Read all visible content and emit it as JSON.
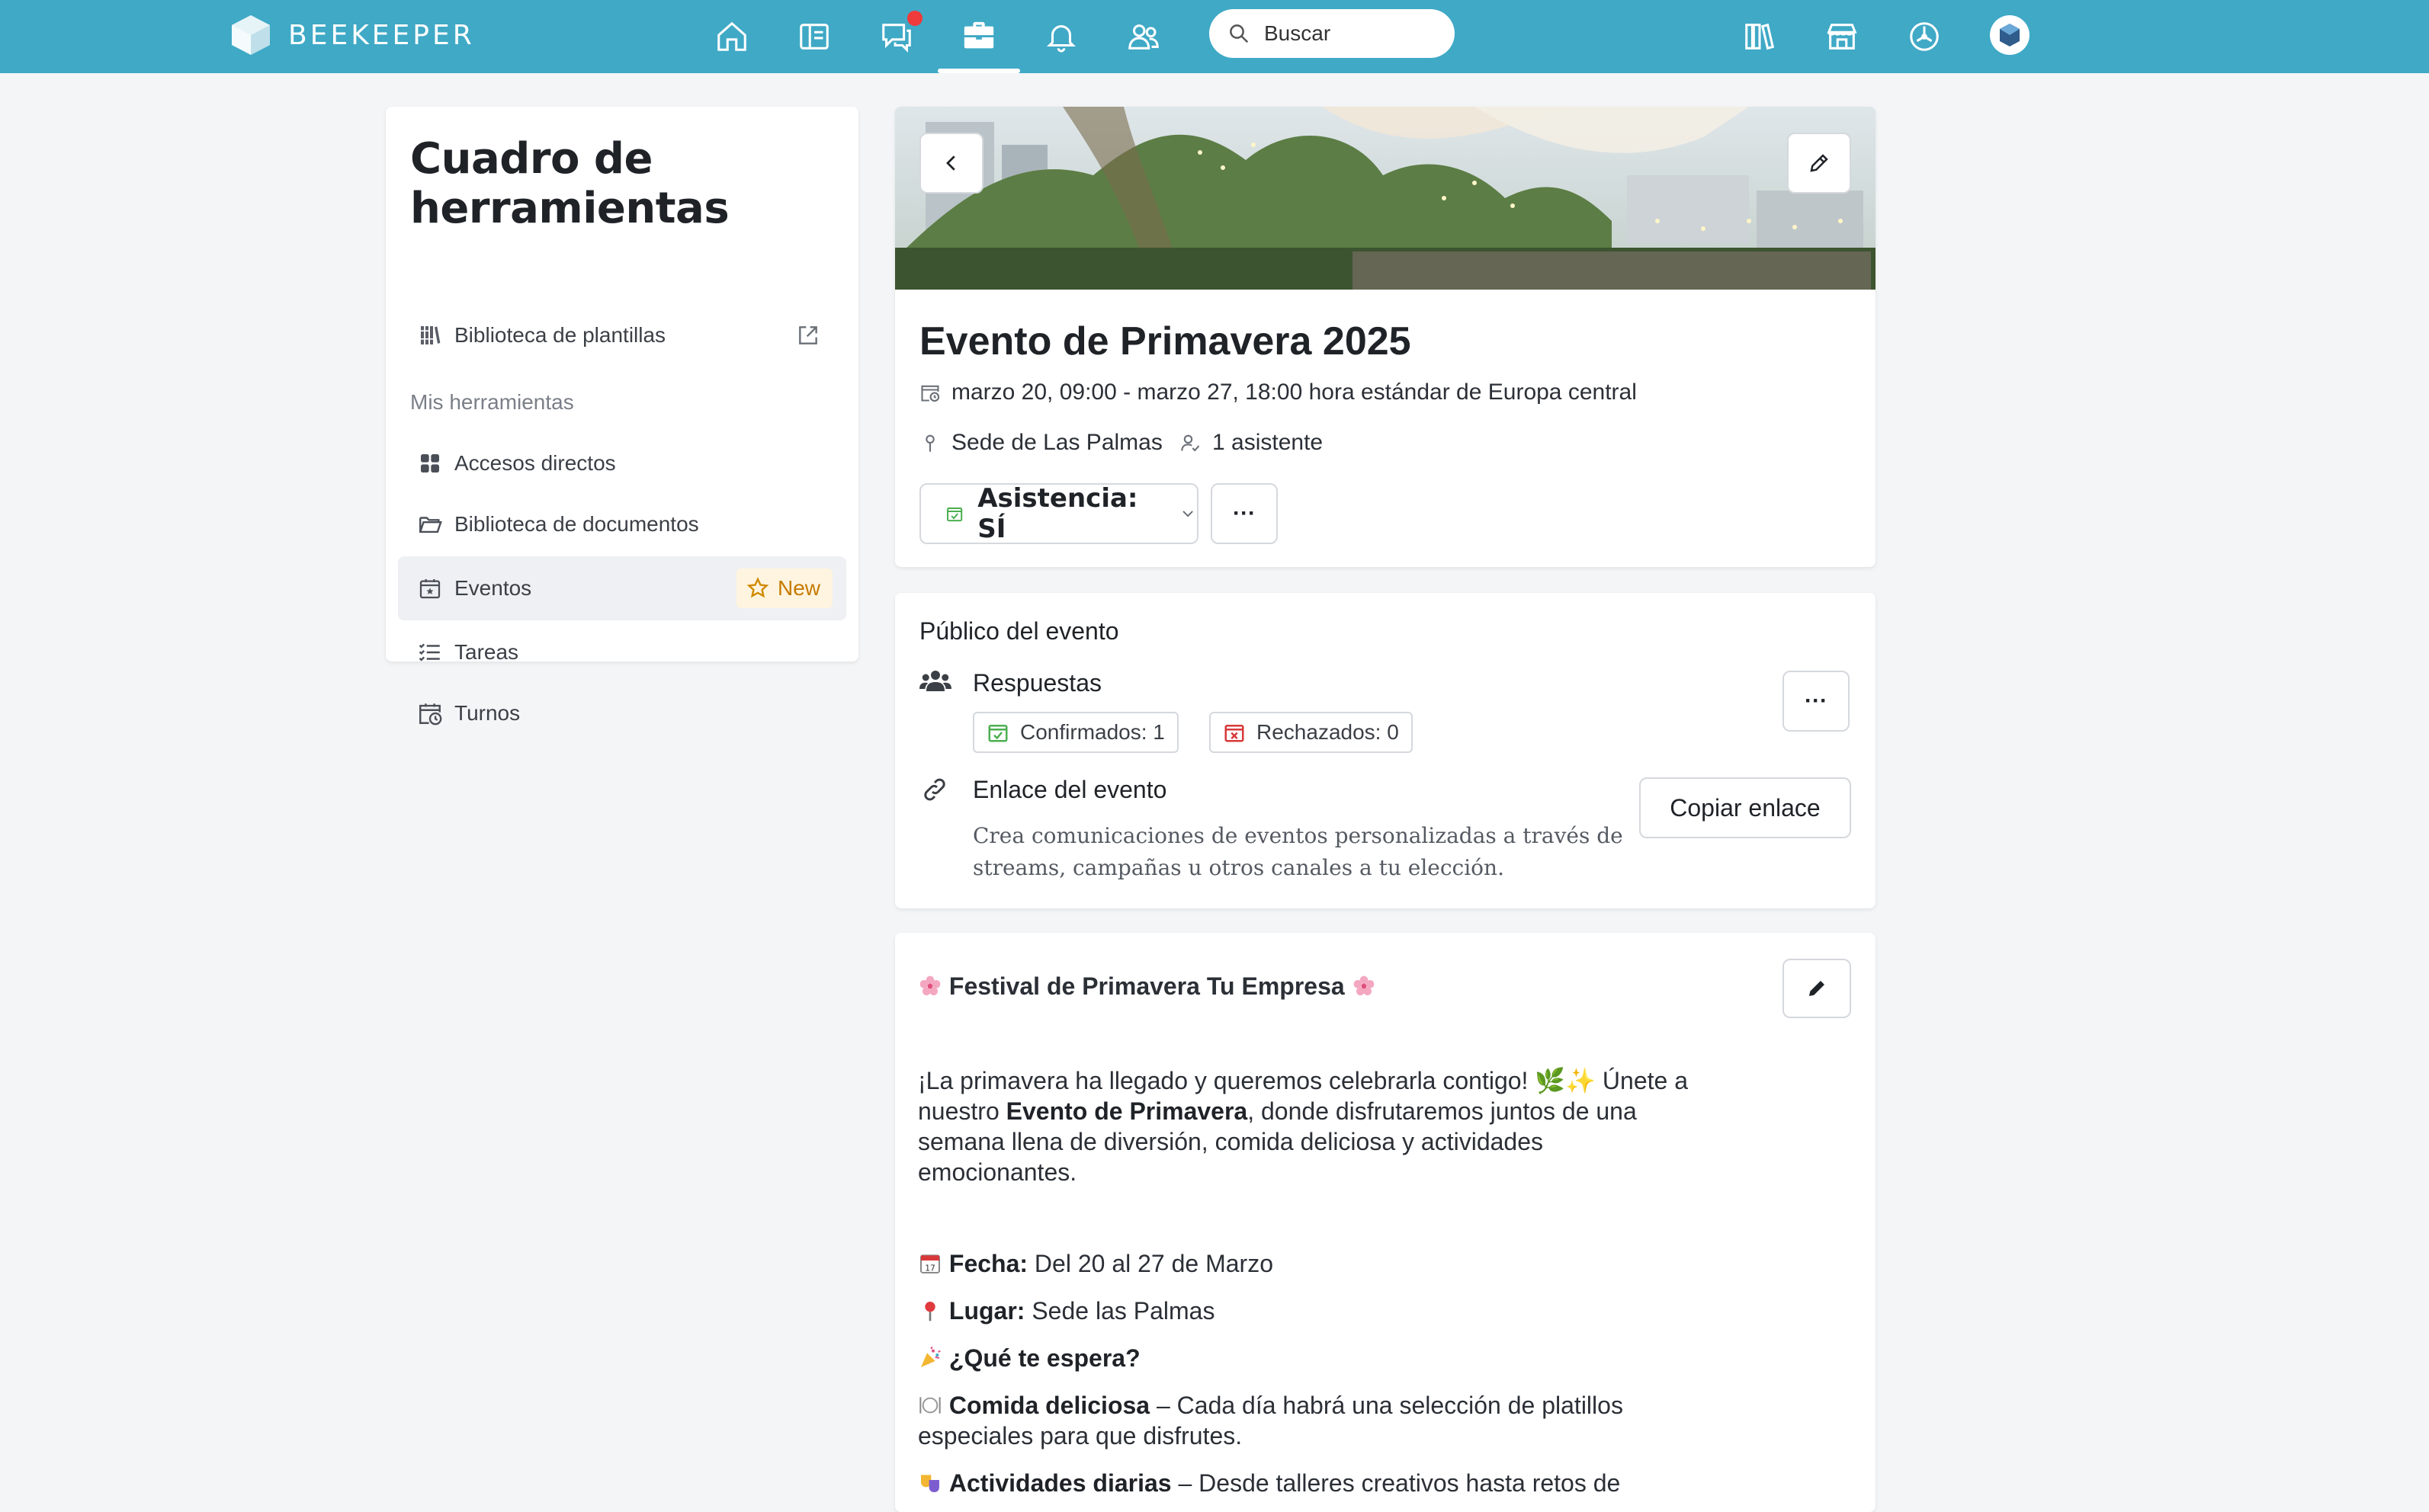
{
  "app": {
    "brand": "BEEKEEPER",
    "nav": [
      "home-icon",
      "newsfeed-icon",
      "chats-icon",
      "toolbox-icon",
      "notifications-icon",
      "people-icon"
    ],
    "right_nav": [
      "library-icon",
      "store-icon",
      "dashboard-icon",
      "profile-avatar"
    ],
    "search_placeholder": "Buscar",
    "accent": "#3fa9c6"
  },
  "sidebar": {
    "title": "Cuadro de herramientas",
    "template_library": "Biblioteca de plantillas",
    "section": "Mis herramientas",
    "items": [
      {
        "label": "Accesos directos",
        "icon": "grid-icon"
      },
      {
        "label": "Biblioteca de documentos",
        "icon": "folder-icon"
      },
      {
        "label": "Eventos",
        "icon": "calendar-star-icon",
        "badge": "New",
        "active": true
      },
      {
        "label": "Tareas",
        "icon": "checklist-icon"
      },
      {
        "label": "Turnos",
        "icon": "calendar-clock-icon"
      }
    ]
  },
  "event": {
    "title": "Evento de Primavera 2025",
    "datetime": "marzo 20, 09:00 - marzo 27, 18:00 hora estándar de Europa central",
    "location": "Sede de Las Palmas",
    "attendees": "1 asistente",
    "attendance_label": "Asistencia: SÍ",
    "more": "···"
  },
  "audience": {
    "title": "Público del evento",
    "responses_label": "Respuestas",
    "confirmed": "Confirmados: 1",
    "rejected": "Rechazados: 0",
    "link_title": "Enlace del evento",
    "link_desc_1": "Crea comunicaciones de eventos personalizadas a través de",
    "link_desc_2": "streams, campañas u otros canales a tu elección.",
    "copy_button": "Copiar enlace",
    "more": "···"
  },
  "description": {
    "heading": "Festival de Primavera Tu Empresa",
    "intro_1": "¡La primavera ha llegado y queremos celebrarla contigo! 🌿✨ Únete a",
    "intro_2a": "nuestro ",
    "intro_2b": "Evento de Primavera",
    "intro_2c": ", donde disfrutaremos juntos de una",
    "intro_3": "semana llena de diversión, comida deliciosa y actividades",
    "intro_4": "emocionantes.",
    "fecha_label": "Fecha:",
    "fecha_value": " Del 20 al 27 de Marzo",
    "lugar_label": "Lugar:",
    "lugar_value": " Sede las Palmas",
    "espera": "¿Qué te espera?",
    "comida_label": "Comida deliciosa",
    "comida_value_1": " – Cada día habrá una selección de platillos",
    "comida_value_2": "especiales para que disfrutes.",
    "actividades_label": "Actividades diarias",
    "actividades_value": " – Desde talleres creativos hasta retos de"
  }
}
